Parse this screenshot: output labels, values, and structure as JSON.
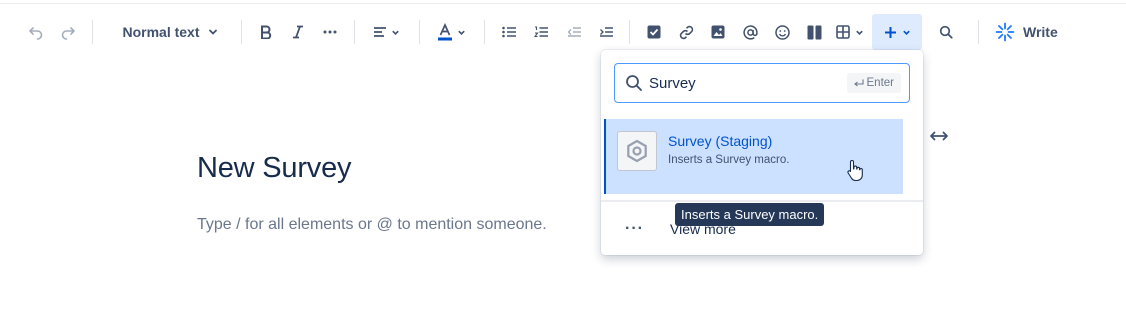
{
  "toolbar": {
    "text_style_label": "Normal text",
    "write_label": "Write"
  },
  "document": {
    "title": "New Survey",
    "placeholder": "Type / for all elements or @ to mention someone."
  },
  "insert_menu": {
    "search_value": "Survey",
    "enter_hint": "Enter",
    "result": {
      "title": "Survey (Staging)",
      "description": "Inserts a Survey macro."
    },
    "view_more_label": "View more"
  },
  "tooltip": {
    "text": "Inserts a Survey macro."
  },
  "colors": {
    "accent": "#0052cc",
    "selection_bg": "#cce0ff",
    "insert_button_bg": "#deebff",
    "tooltip_bg": "#253858",
    "text_color_underline": "#0052cc",
    "write_icon": "#1d7afc"
  }
}
